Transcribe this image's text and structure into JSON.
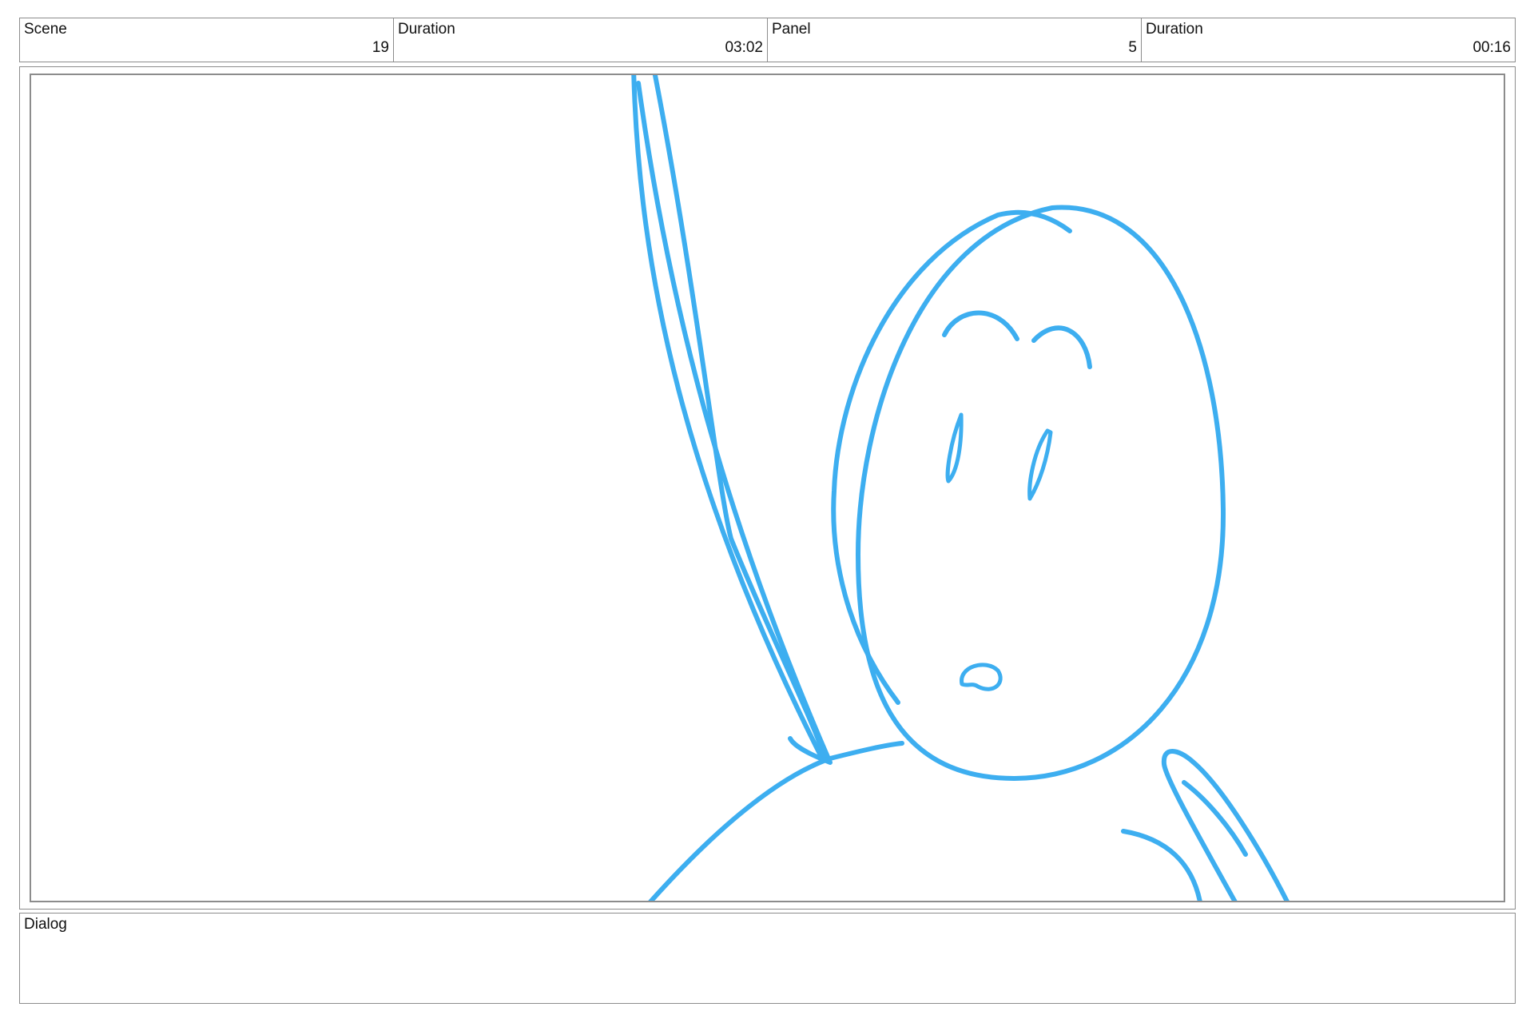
{
  "header": {
    "scene_label": "Scene",
    "scene_value": "19",
    "scene_duration_label": "Duration",
    "scene_duration_value": "03:02",
    "panel_label": "Panel",
    "panel_value": "5",
    "panel_duration_label": "Duration",
    "panel_duration_value": "00:16"
  },
  "drawing": {
    "stroke_color": "#3daef0",
    "subject": "character-sketch"
  },
  "dialog": {
    "label": "Dialog",
    "text": ""
  }
}
